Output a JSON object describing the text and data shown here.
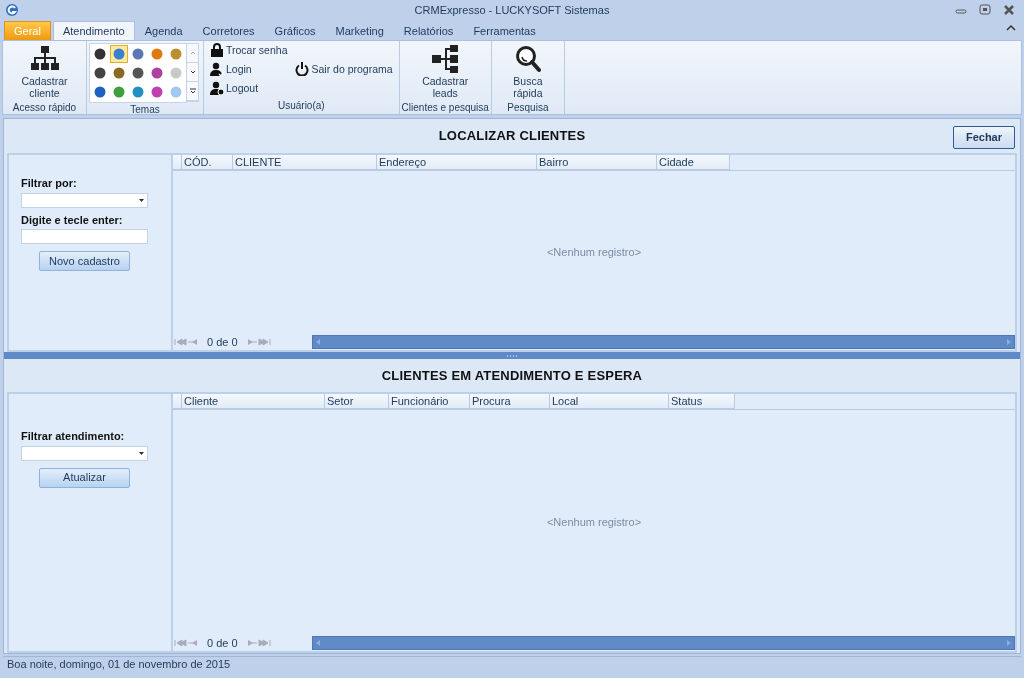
{
  "window": {
    "title": "CRMExpresso - LUCKYSOFT Sistemas"
  },
  "tabs": [
    {
      "label": "Geral",
      "kind": "app-menu",
      "selected": false
    },
    {
      "label": "Atendimento",
      "kind": "tab",
      "selected": true
    },
    {
      "label": "Agenda",
      "kind": "tab",
      "selected": false
    },
    {
      "label": "Corretores",
      "kind": "tab",
      "selected": false
    },
    {
      "label": "Gráficos",
      "kind": "tab",
      "selected": false
    },
    {
      "label": "Marketing",
      "kind": "tab",
      "selected": false
    },
    {
      "label": "Relatórios",
      "kind": "tab",
      "selected": false
    },
    {
      "label": "Ferramentas",
      "kind": "tab",
      "selected": false
    }
  ],
  "ribbon": {
    "groups": [
      {
        "label": "Acesso rápido",
        "kind": "large",
        "buttons": [
          {
            "label": "Cadastrar cliente"
          }
        ]
      },
      {
        "label": "Temas",
        "kind": "gallery",
        "themes": [
          {
            "color": "#333333",
            "selected": false
          },
          {
            "color": "#3a7fd0",
            "selected": true
          },
          {
            "color": "#5a78b8",
            "selected": false
          },
          {
            "color": "#e07a10",
            "selected": false
          },
          {
            "color": "#b89030",
            "selected": false
          },
          {
            "color": "#444444",
            "selected": false
          },
          {
            "color": "#8a6a20",
            "selected": false
          },
          {
            "color": "#555555",
            "selected": false
          },
          {
            "color": "#b040a0",
            "selected": false
          },
          {
            "color": "#c8c8c8",
            "selected": false
          },
          {
            "color": "#2060c0",
            "selected": false
          },
          {
            "color": "#40a040",
            "selected": false
          },
          {
            "color": "#2090c0",
            "selected": false
          },
          {
            "color": "#c040b0",
            "selected": false
          },
          {
            "color": "#a0c8f0",
            "selected": false
          }
        ]
      },
      {
        "label": "Usuário(a)",
        "kind": "small",
        "buttons": [
          {
            "label": "Trocar senha"
          },
          {
            "label": "Login"
          },
          {
            "label": "Logout"
          },
          {
            "label": "Sair do programa"
          }
        ]
      },
      {
        "label": "Clientes e pesquisa",
        "kind": "large",
        "buttons": [
          {
            "label": "Cadastrar leads"
          }
        ]
      },
      {
        "label": "Pesquisa",
        "kind": "large",
        "buttons": [
          {
            "label": "Busca rápida"
          }
        ]
      }
    ]
  },
  "sections": [
    {
      "title": "LOCALIZAR CLIENTES",
      "close_button": "Fechar",
      "filters": [
        {
          "label": "Filtrar por:",
          "kind": "dropdown"
        },
        {
          "label": "Digite e tecle enter:",
          "kind": "text"
        }
      ],
      "action_button": "Novo cadastro",
      "columns": [
        "CÓD.",
        "CLIENTE",
        "Endereço",
        "Bairro",
        "Cidade"
      ],
      "empty_text": "<Nenhum registro>",
      "pager": "0 de 0"
    },
    {
      "title": "CLIENTES EM ATENDIMENTO E ESPERA",
      "filters": [
        {
          "label": "Filtrar atendimento:",
          "kind": "dropdown"
        }
      ],
      "action_button": "Atualizar",
      "columns": [
        "Cliente",
        "Setor",
        "Funcionário",
        "Procura",
        "Local",
        "Status"
      ],
      "empty_text": "<Nenhum registro>",
      "pager": "0 de 0"
    }
  ],
  "status_bar": "Boa noite, domingo, 01 de novembro de 2015"
}
